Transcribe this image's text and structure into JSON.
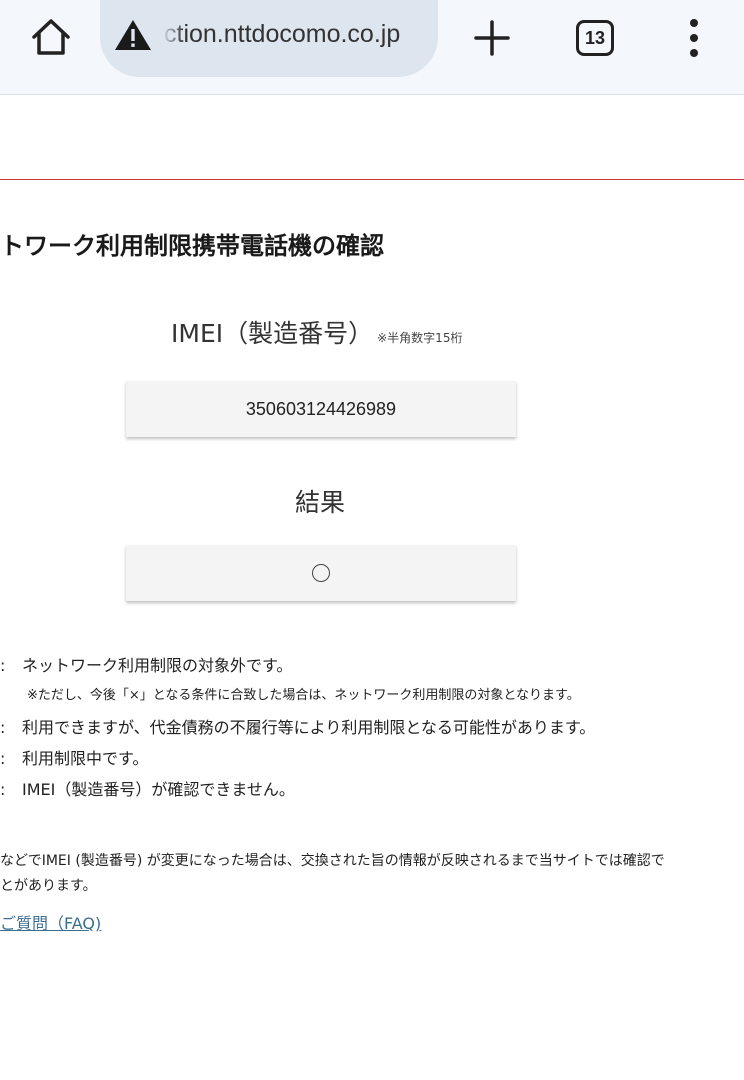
{
  "browser": {
    "url": "ction.nttdocomo.co.jp",
    "tab_count": "13"
  },
  "page": {
    "heading": "トワーク利用制限携帯電話機の確認",
    "imei_label": "IMEI（製造番号）",
    "imei_note": "※半角数字15桁",
    "imei_value": "350603124426989",
    "result_label": "結果",
    "result_value": "○"
  },
  "legend": [
    {
      "colon": ":",
      "text": "ネットワーク利用制限の対象外です。"
    },
    {
      "colon": ":",
      "text": "利用できますが、代金債務の不履行等により利用制限となる可能性があります。"
    },
    {
      "colon": ":",
      "text": "利用制限中です。"
    },
    {
      "colon": ":",
      "text": "IMEI（製造番号）が確認できません。"
    }
  ],
  "legend_note": "※ただし、今後「×」となる条件に合致した場合は、ネットワーク利用制限の対象となります。",
  "notice": {
    "line1": "などでIMEI (製造番号) が変更になった場合は、交換された旨の情報が反映されるまで当サイトでは確認で",
    "line2": "とがあります。"
  },
  "faq_link": "ご質問（FAQ)"
}
